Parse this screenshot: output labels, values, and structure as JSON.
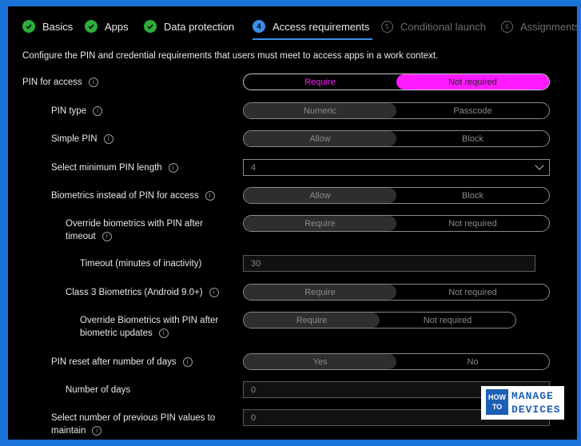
{
  "tabs": [
    {
      "label": "Basics",
      "state": "done",
      "icon": "check-icon"
    },
    {
      "label": "Apps",
      "state": "done",
      "icon": "check-icon"
    },
    {
      "label": "Data protection",
      "state": "done",
      "icon": "check-icon"
    },
    {
      "label": "Access requirements",
      "state": "current",
      "number": "4"
    },
    {
      "label": "Conditional launch",
      "state": "future",
      "number": "5"
    },
    {
      "label": "Assignments",
      "state": "future",
      "number": "6"
    }
  ],
  "description": "Configure the PIN and credential requirements that users must meet to access apps in a work context.",
  "settings": {
    "pin_for_access": {
      "label": "PIN for access",
      "options": [
        "Require",
        "Not required"
      ],
      "selected": "Not required"
    },
    "pin_type": {
      "label": "PIN type",
      "options": [
        "Numeric",
        "Passcode"
      ]
    },
    "simple_pin": {
      "label": "Simple PIN",
      "options": [
        "Allow",
        "Block"
      ]
    },
    "min_pin_length": {
      "label": "Select minimum PIN length",
      "value": "4"
    },
    "biometrics": {
      "label": "Biometrics instead of PIN for access",
      "options": [
        "Allow",
        "Block"
      ]
    },
    "override_biometrics": {
      "label_line1": "Override biometrics with PIN after",
      "label_line2": "timeout",
      "options": [
        "Require",
        "Not required"
      ]
    },
    "timeout": {
      "label": "Timeout (minutes of inactivity)",
      "value": "30"
    },
    "class3": {
      "label": "Class 3 Biometrics (Android 9.0+)",
      "options": [
        "Require",
        "Not required"
      ]
    },
    "override_updates": {
      "label_line1": "Override Biometrics with PIN after",
      "label_line2": "biometric updates",
      "options": [
        "Require",
        "Not required"
      ]
    },
    "pin_reset": {
      "label": "PIN reset after number of days",
      "options": [
        "Yes",
        "No"
      ]
    },
    "number_of_days": {
      "label": "Number of days",
      "value": "0"
    },
    "previous_pins": {
      "label_line1": "Select number of previous PIN values to",
      "label_line2": "maintain",
      "value": "0"
    }
  },
  "info_glyph": "i",
  "logo": {
    "how": "HOW",
    "to": "TO",
    "manage": "MANAGE",
    "devices": "DEVICES"
  },
  "colors": {
    "accent_magenta": "#ff1aff",
    "tab_done": "#2cae3a",
    "tab_current": "#3b8ee8",
    "border_blue": "#1a73d9"
  }
}
